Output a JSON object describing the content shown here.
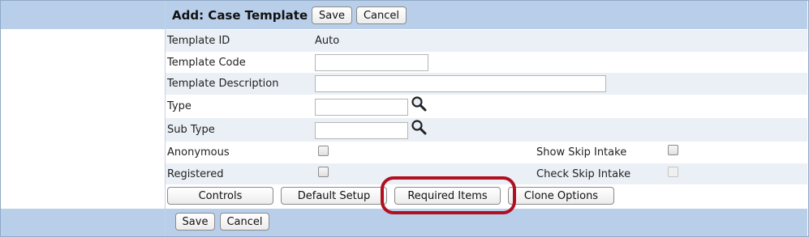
{
  "header": {
    "title": "Add: Case Template",
    "save_label": "Save",
    "cancel_label": "Cancel"
  },
  "fields": {
    "template_id": {
      "label": "Template ID",
      "value": "Auto"
    },
    "template_code": {
      "label": "Template Code",
      "value": ""
    },
    "template_description": {
      "label": "Template Description",
      "value": ""
    },
    "type": {
      "label": "Type",
      "value": ""
    },
    "sub_type": {
      "label": "Sub Type",
      "value": ""
    },
    "anonymous": {
      "label": "Anonymous",
      "checked": false
    },
    "show_skip_intake": {
      "label": "Show Skip Intake",
      "checked": false
    },
    "registered": {
      "label": "Registered",
      "checked": false
    },
    "check_skip_intake": {
      "label": "Check Skip Intake",
      "checked": false,
      "disabled": true
    }
  },
  "action_buttons": {
    "controls": "Controls",
    "default_setup": "Default Setup",
    "required_items": "Required Items",
    "clone_options": "Clone Options"
  },
  "footer": {
    "save_label": "Save",
    "cancel_label": "Cancel"
  },
  "icons": {
    "lookup": "magnifier-icon"
  },
  "colors": {
    "header_band": "#b9cfe9",
    "row_alt": "#eaf0f6",
    "highlight": "#b01020"
  }
}
